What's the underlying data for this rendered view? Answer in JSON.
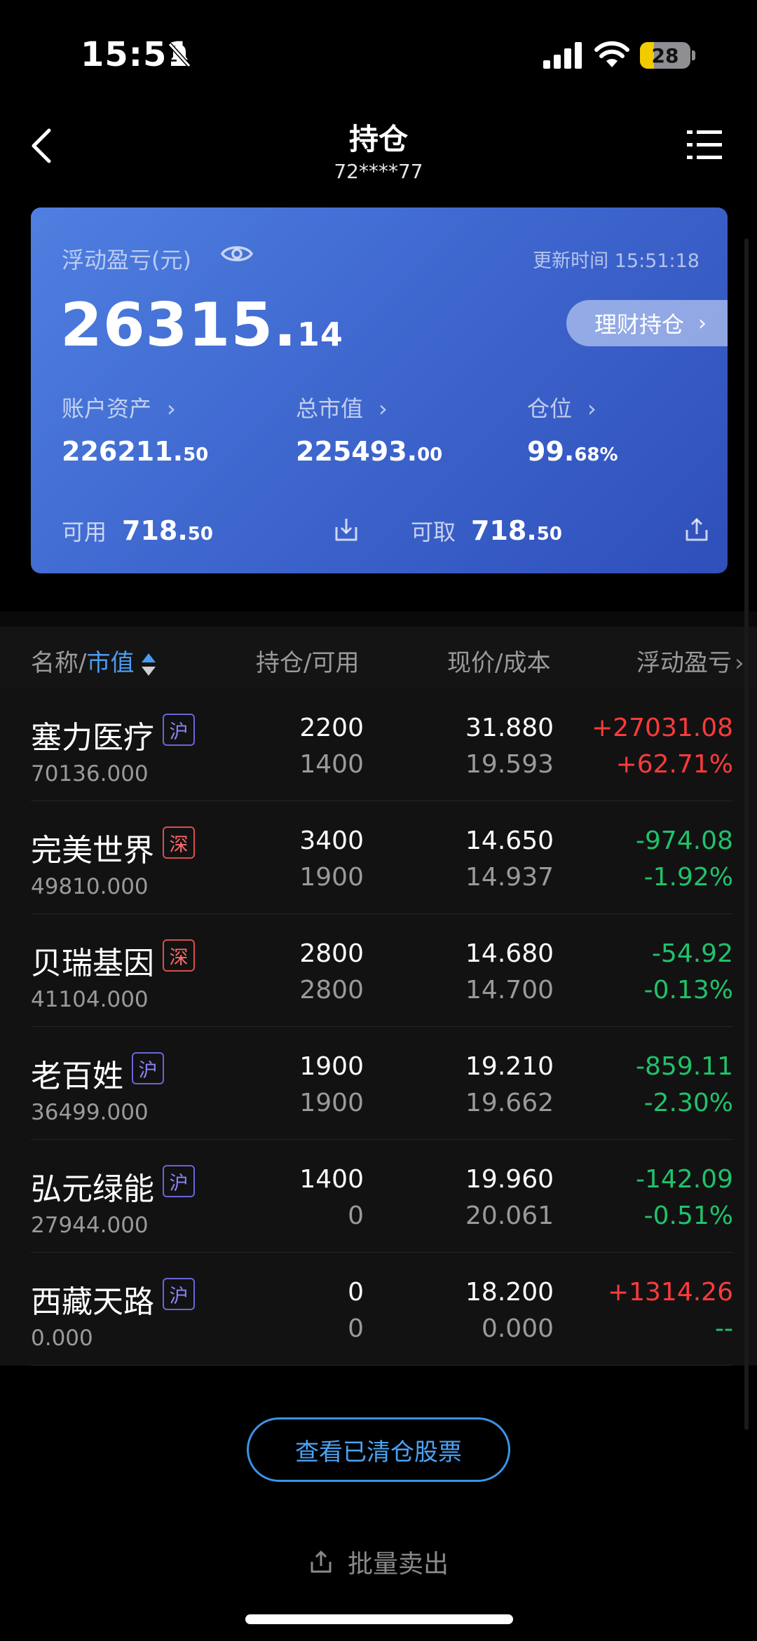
{
  "status": {
    "time": "15:51",
    "battery": "28",
    "battery_level": 0.28
  },
  "header": {
    "title": "持仓",
    "account": "72****77"
  },
  "summary": {
    "pnl_label": "浮动盈亏(元)",
    "update_time": "更新时间 15:51:18",
    "pnl_int": "26315.",
    "pnl_dec": "14",
    "wealth_button": "理财持仓",
    "stats": [
      {
        "label": "账户资产",
        "int": "226211.",
        "dec": "50"
      },
      {
        "label": "总市值",
        "int": "225493.",
        "dec": "00"
      },
      {
        "label": "仓位",
        "int": "99.",
        "dec": "68%"
      }
    ],
    "available_label": "可用",
    "available_int": "718.",
    "available_dec": "50",
    "withdrawable_label": "可取",
    "withdrawable_int": "718.",
    "withdrawable_dec": "50"
  },
  "table": {
    "col_name": "名称/",
    "col_name_sort": "市值",
    "col_hold": "持仓/可用",
    "col_price": "现价/成本",
    "col_pnl": "浮动盈亏",
    "rows": [
      {
        "name": "塞力医疗",
        "market": "沪",
        "value": "70136.000",
        "hold": "2200",
        "avail": "1400",
        "price": "31.880",
        "cost": "19.593",
        "pnl": "+27031.08",
        "pct": "+62.71%"
      },
      {
        "name": "完美世界",
        "market": "深",
        "value": "49810.000",
        "hold": "3400",
        "avail": "1900",
        "price": "14.650",
        "cost": "14.937",
        "pnl": "-974.08",
        "pct": "-1.92%"
      },
      {
        "name": "贝瑞基因",
        "market": "深",
        "value": "41104.000",
        "hold": "2800",
        "avail": "2800",
        "price": "14.680",
        "cost": "14.700",
        "pnl": "-54.92",
        "pct": "-0.13%"
      },
      {
        "name": "老百姓",
        "market": "沪",
        "value": "36499.000",
        "hold": "1900",
        "avail": "1900",
        "price": "19.210",
        "cost": "19.662",
        "pnl": "-859.11",
        "pct": "-2.30%"
      },
      {
        "name": "弘元绿能",
        "market": "沪",
        "value": "27944.000",
        "hold": "1400",
        "avail": "0",
        "price": "19.960",
        "cost": "20.061",
        "pnl": "-142.09",
        "pct": "-0.51%"
      },
      {
        "name": "西藏天路",
        "market": "沪",
        "value": "0.000",
        "hold": "0",
        "avail": "0",
        "price": "18.200",
        "cost": "0.000",
        "pnl": "+1314.26",
        "pct": "--"
      }
    ]
  },
  "footer": {
    "cleared_button": "查看已清仓股票",
    "batch_sell": "批量卖出"
  },
  "colors": {
    "up": "#ff3b3b",
    "down": "#1fc26b",
    "accent": "#3a94e8",
    "card": "#3f68cf"
  }
}
